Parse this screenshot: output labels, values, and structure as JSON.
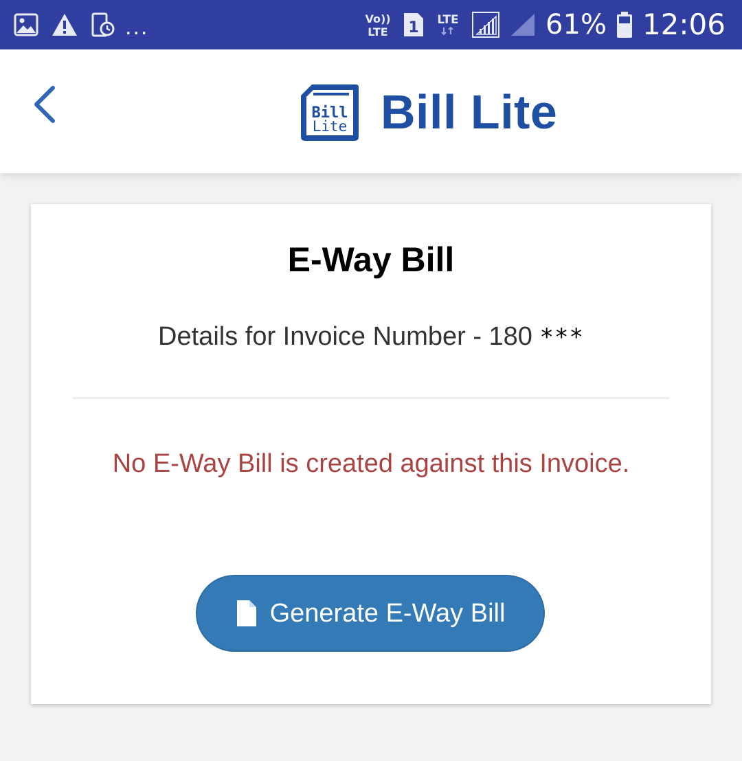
{
  "status_bar": {
    "left_icons": [
      "image-icon",
      "warning-icon",
      "screen-timer-icon"
    ],
    "overflow_dots": "...",
    "volte_label": "Vo))\nLTE",
    "sim_slot": "1",
    "network_type": "LTE",
    "battery_percent": "61%",
    "clock": "12:06"
  },
  "header": {
    "back_icon": "chevron-left-icon",
    "logo_icon": "bill-lite-logo",
    "logo_text_line1": "Bill",
    "logo_text_line2": "Lite",
    "app_name": "Bill Lite"
  },
  "card": {
    "title": "E-Way Bill",
    "invoice_label": "Details for Invoice Number - 180",
    "invoice_mask": "***",
    "warning": "No E-Way Bill is created against this Invoice.",
    "generate_button": {
      "icon": "file-icon",
      "label": "Generate E-Way Bill"
    }
  },
  "colors": {
    "status_bar": "#303f9f",
    "brand": "#1e4fa3",
    "back_chevron": "#2f66b5",
    "warning": "#a94442",
    "button": "#337ab7",
    "page_background": "#f2f2f2"
  }
}
